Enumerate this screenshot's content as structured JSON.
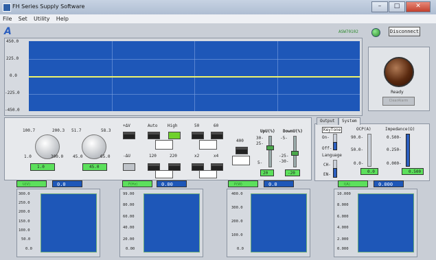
{
  "window": {
    "title": "FH Series Supply Software"
  },
  "menu": [
    "File",
    "Set",
    "Utility",
    "Help"
  ],
  "header": {
    "logo": "A",
    "device_id": "ASW70102",
    "disconnect_label": "Disconnect"
  },
  "main_graph": {
    "y_ticks": [
      "450.0",
      "225.0",
      "0.0",
      "-225.0",
      "-450.0"
    ],
    "ylim": [
      -450,
      450
    ],
    "trace_value": 0.0
  },
  "status": {
    "ready_label": "Ready",
    "clear_alarm_label": "ClearAlarm"
  },
  "knob1": {
    "ticks": [
      "100.7",
      "200.3",
      "1.0",
      "300.0"
    ],
    "value": "1.0"
  },
  "knob2": {
    "ticks": [
      "51.7",
      "58.3",
      "45.0",
      "65.0"
    ],
    "value": "45.0"
  },
  "buttons_grid": {
    "row1_labels": [
      "+ΔV",
      "Auto",
      "High",
      "50",
      "60"
    ],
    "row2_labels": [
      "-ΔU",
      "120",
      "220",
      "x2",
      "x4"
    ],
    "side_label": "400"
  },
  "upu": {
    "label": "UpU(%)",
    "ticks": [
      "30-",
      "25-",
      "5-"
    ],
    "value": "20"
  },
  "downu": {
    "label": "DownU(%)",
    "ticks": [
      "-5-",
      "-25-",
      "-30-"
    ],
    "value": "-20"
  },
  "tabs": {
    "items": [
      "Output",
      "System"
    ],
    "active": "System"
  },
  "system": {
    "keytone_label": "KeyTone",
    "on_label": "On-",
    "off_label": "Off-",
    "language_label": "Language",
    "ch_label": "CH-",
    "en_label": "EN-",
    "ocp_label": "OCP(A)",
    "ocp_ticks": [
      "90.0-",
      "50.0-",
      "0.0-"
    ],
    "ocp_value": "0.0",
    "imp_label": "Impedance(Ω)",
    "imp_ticks": [
      "0.500-",
      "0.250-",
      "0.000-"
    ],
    "imp_value": "0.500"
  },
  "meters": [
    {
      "title": "U(V)",
      "value": "0.0",
      "ticks": [
        "300.0",
        "250.0",
        "200.0",
        "150.0",
        "100.0",
        "50.0",
        "0.0"
      ]
    },
    {
      "title": "F(Hz)",
      "value": "0.00",
      "ticks": [
        "99.00",
        "80.00",
        "60.00",
        "40.00",
        "20.00",
        "0.00"
      ]
    },
    {
      "title": "P(W)",
      "value": "0.0",
      "ticks": [
        "400.0",
        "300.0",
        "200.0",
        "100.0",
        "0.0"
      ]
    },
    {
      "title": "I(A)",
      "value": "0.000",
      "ticks": [
        "10.000",
        "8.000",
        "6.000",
        "4.000",
        "2.000",
        "0.000"
      ]
    }
  ],
  "colors": {
    "plot_bg": "#1e57b8",
    "trace": "#f0f56a",
    "led_green": "#5ce05c"
  }
}
